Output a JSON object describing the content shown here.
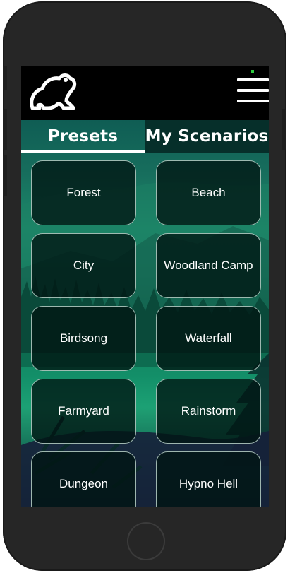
{
  "tabs": [
    {
      "label": "Presets",
      "active": true
    },
    {
      "label": "My Scenarios",
      "active": false
    }
  ],
  "presets": [
    "Forest",
    "Beach",
    "City",
    "Woodland Camp",
    "Birdsong",
    "Waterfall",
    "Farmyard",
    "Rainstorm",
    "Dungeon",
    "Hypno Hell"
  ],
  "icons": {
    "logo": "frog-logo-icon",
    "menu": "hamburger-menu-icon"
  },
  "colors": {
    "accent_teal": "#062f2a",
    "status_indicator": "#2ecc40"
  }
}
